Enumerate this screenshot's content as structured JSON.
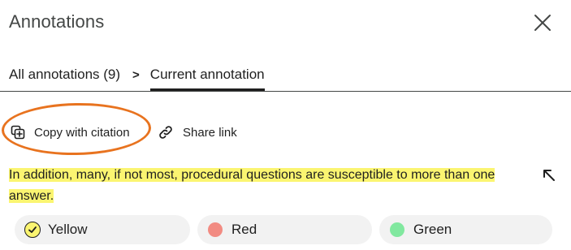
{
  "panel": {
    "title": "Annotations",
    "close_icon": "close-icon"
  },
  "breadcrumb": {
    "all_label": "All annotations (9)",
    "separator": ">",
    "current_label": "Current annotation"
  },
  "actions": {
    "copy_label": "Copy with citation",
    "copy_icon": "copy-icon",
    "share_label": "Share link",
    "share_icon": "link-icon"
  },
  "annotation": {
    "text": "In addition, many, if not most, procedural questions are susceptible to more than one answer.",
    "highlight_color": "#fbf571",
    "goto_icon": "arrow-up-left-icon"
  },
  "colors": [
    {
      "label": "Yellow",
      "hex": "#fbf571",
      "selected": true
    },
    {
      "label": "Red",
      "hex": "#f28b82",
      "selected": false
    },
    {
      "label": "Green",
      "hex": "#81e89f",
      "selected": false
    }
  ],
  "callout_color": "#e8731f"
}
